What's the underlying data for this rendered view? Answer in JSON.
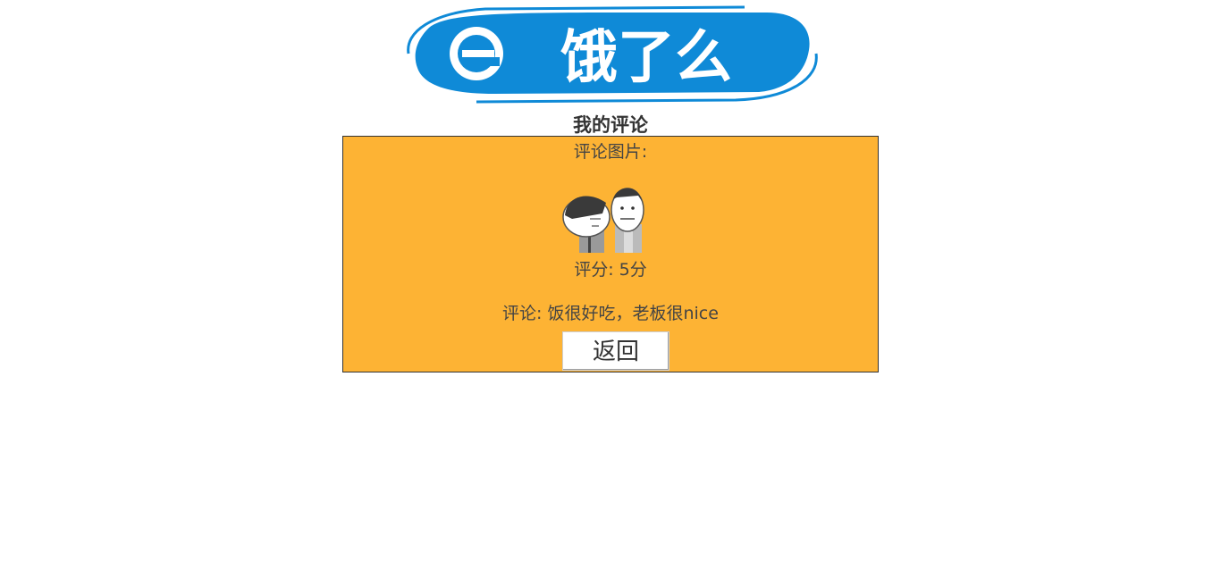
{
  "header": {
    "logo_alt": "饿了么",
    "logo_text": "饿了么",
    "brand_color": "#0f8ad7"
  },
  "page": {
    "title": "我的评论"
  },
  "comment": {
    "image_label": "评论图片:",
    "image_icon": "meme-two-cartoon-faces",
    "score_label": "评分: 5分",
    "text": "评论: 饭很好吃，老板很nice",
    "back_button": "返回",
    "panel_color": "#fdb334"
  }
}
